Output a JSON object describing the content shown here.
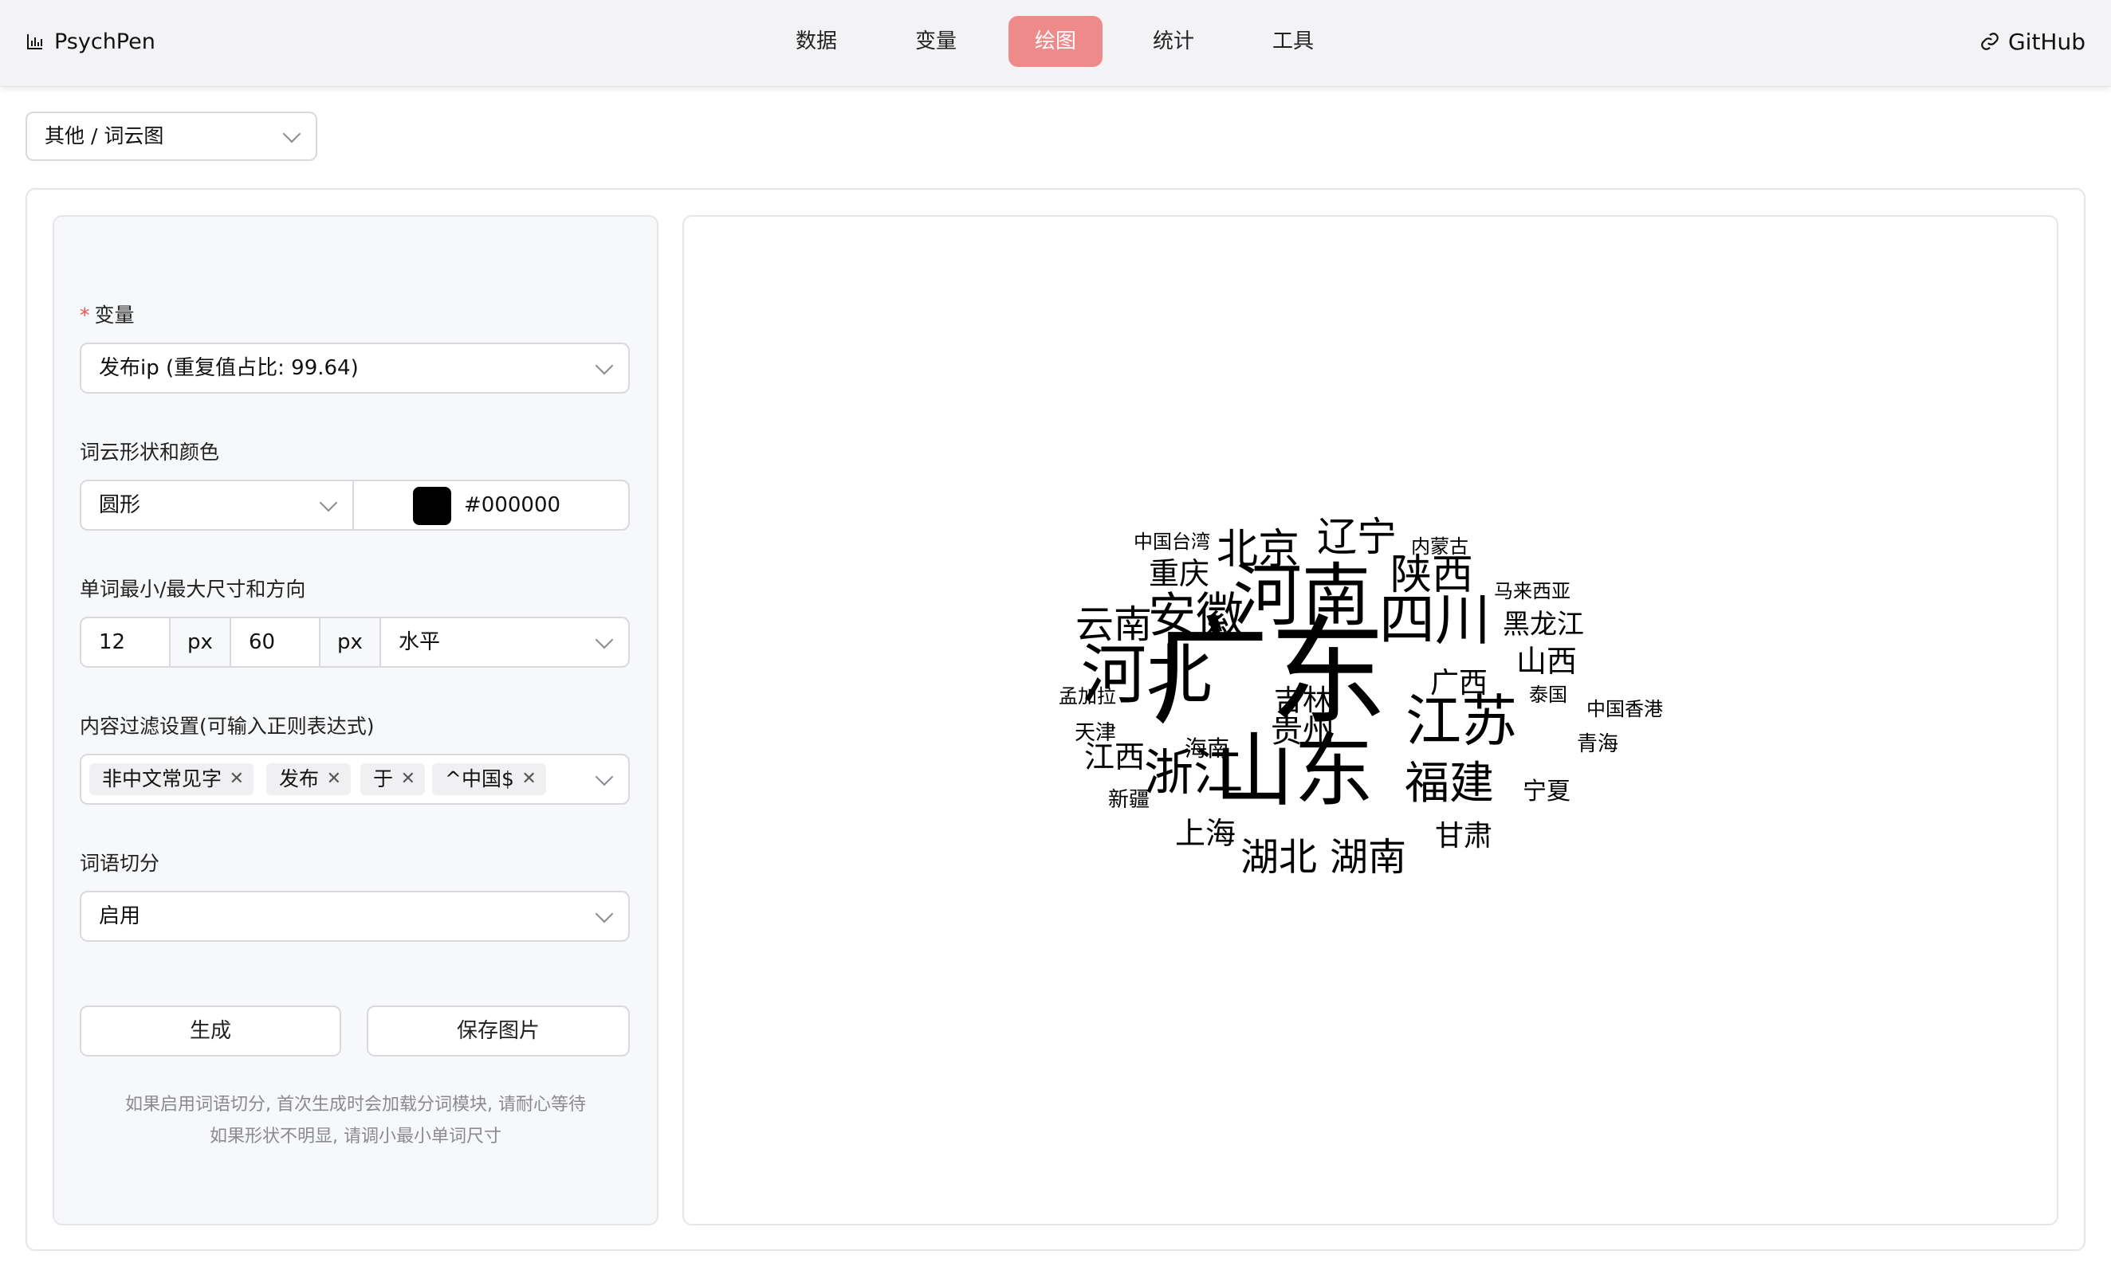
{
  "app": {
    "title": "PsychPen",
    "github": "GitHub"
  },
  "nav": {
    "items": [
      "数据",
      "变量",
      "绘图",
      "统计",
      "工具"
    ],
    "active": "绘图"
  },
  "chart_type": "其他 / 词云图",
  "form": {
    "variable": {
      "label": "变量",
      "value": "发布ip (重复值占比: 99.64)"
    },
    "shape_color": {
      "label": "词云形状和颜色",
      "shape": "圆形",
      "color": "#000000"
    },
    "size_dir": {
      "label": "单词最小/最大尺寸和方向",
      "min": "12",
      "max": "60",
      "unit": "px",
      "direction": "水平"
    },
    "filter": {
      "label": "内容过滤设置(可输入正则表达式)",
      "tags": [
        "非中文常见字",
        "发布",
        "于",
        "^中国$"
      ]
    },
    "segment": {
      "label": "词语切分",
      "value": "启用"
    },
    "buttons": {
      "generate": "生成",
      "save": "保存图片"
    },
    "hints": [
      "如果启用词语切分, 首次生成时会加载分词模块, 请耐心等待",
      "如果形状不明显, 请调小最小单词尺寸"
    ]
  },
  "wordcloud": {
    "color": "#000000",
    "words": [
      "广东",
      "山东",
      "河南",
      "河北",
      "四川",
      "江苏",
      "浙江",
      "安徽",
      "福建",
      "陕西",
      "北京",
      "辽宁",
      "湖北",
      "湖南",
      "云南",
      "江西",
      "重庆",
      "上海",
      "广西",
      "山西",
      "吉林",
      "贵州",
      "黑龙江",
      "甘肃",
      "海南",
      "天津",
      "新疆",
      "宁夏",
      "青海",
      "泰国",
      "内蒙古",
      "马来西亚",
      "中国台湾",
      "中国香港",
      "孟加拉"
    ]
  }
}
